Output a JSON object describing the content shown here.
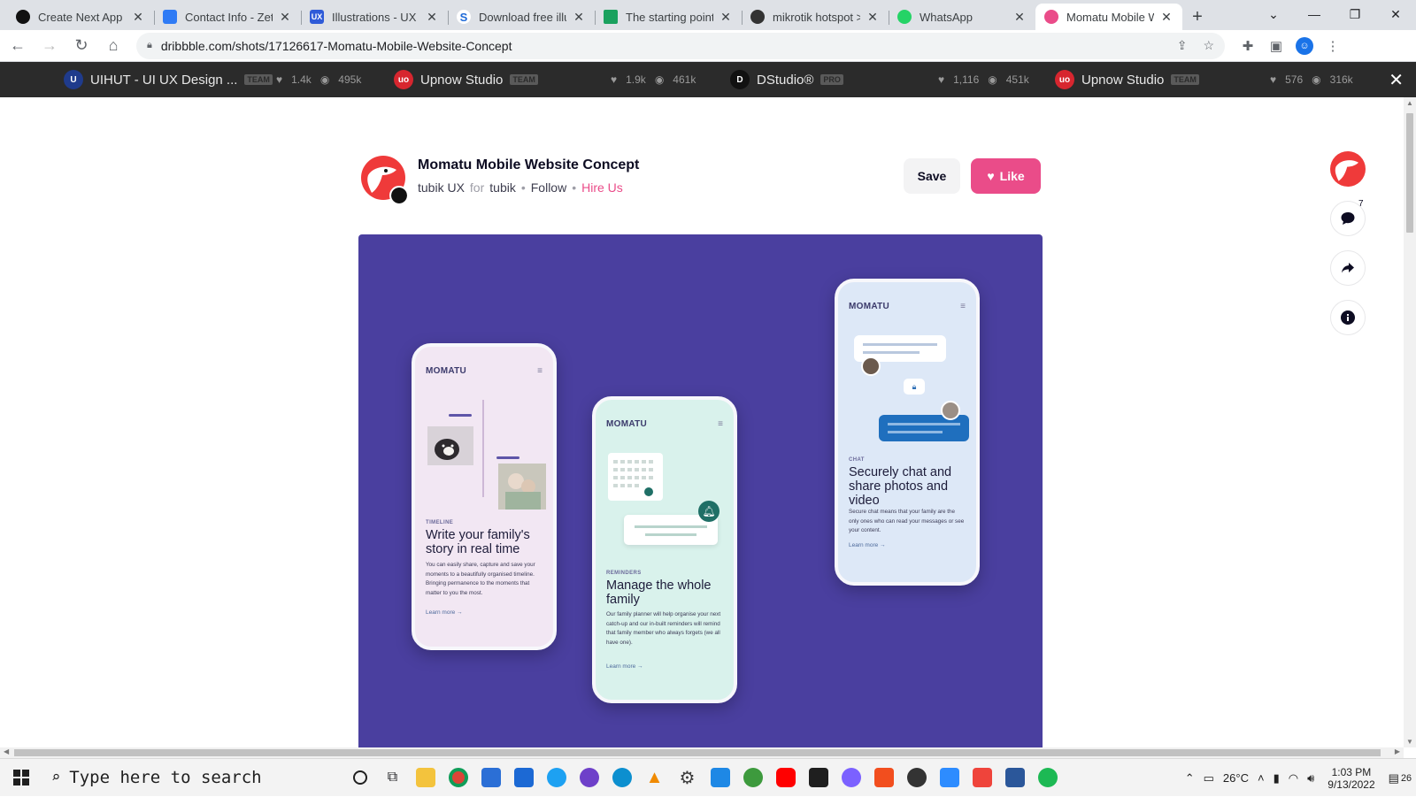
{
  "browser": {
    "tabs": [
      {
        "title": "Create Next App",
        "favicon_color": "#111111"
      },
      {
        "title": "Contact Info - Zety",
        "favicon_color": "#2f7bf5"
      },
      {
        "title": "Illustrations - UX Li",
        "favicon_color": "#2f5bd8",
        "favicon_text": "UX"
      },
      {
        "title": "Download free illus",
        "favicon_color": "#1e6ad8",
        "favicon_text": "S"
      },
      {
        "title": "The starting point f",
        "favicon_color": "#1aa15e"
      },
      {
        "title": "mikrotik hotspot >",
        "favicon_color": "#333333"
      },
      {
        "title": "WhatsApp",
        "favicon_color": "#25d366"
      },
      {
        "title": "Momatu Mobile W",
        "favicon_color": "#ea4c89",
        "active": true
      }
    ],
    "url": "dribbble.com/shots/17126617-Momatu-Mobile-Website-Concept"
  },
  "top_strip": {
    "items": [
      {
        "name": "UIHUT - UI UX Design ...",
        "badge": "TEAM",
        "likes": "1.4k",
        "views": "495k",
        "logo_color": "#1f3b8c",
        "logo_text": "U"
      },
      {
        "name": "Upnow Studio",
        "badge": "TEAM",
        "likes": "1.9k",
        "views": "461k",
        "logo_color": "#d7262f",
        "logo_text": "uo"
      },
      {
        "name": "DStudio®",
        "badge": "PRO",
        "likes": "1,116",
        "views": "451k",
        "logo_color": "#111111",
        "logo_text": "D"
      },
      {
        "name": "Upnow Studio",
        "badge": "TEAM",
        "likes": "576",
        "views": "316k",
        "logo_color": "#d7262f",
        "logo_text": "uo"
      }
    ]
  },
  "shot": {
    "title": "Momatu Mobile Website Concept",
    "author": "tubik UX",
    "for_word": "for",
    "team": "tubik",
    "follow": "Follow",
    "hire": "Hire Us",
    "save_label": "Save",
    "like_label": "Like",
    "comment_count": "7",
    "background_color": "#4a3f9f"
  },
  "phones": {
    "brand": "MOMATU",
    "one": {
      "tag": "TIMELINE",
      "heading": "Write your family's story in real time",
      "body": "You can easily share, capture and save your moments to a beautifully organised timeline. Bringing permanence to the moments that matter to you the most.",
      "link": "Learn more →"
    },
    "two": {
      "tag": "REMINDERS",
      "heading": "Manage the whole family",
      "body": "Our family planner will help organise your next catch-up and our in-built reminders will remind that family member who always forgets (we all have one).",
      "link": "Learn more →"
    },
    "three": {
      "tag": "CHAT",
      "heading": "Securely chat and share photos and video",
      "body": "Secure chat means that your family are the only ones who can read your messages or see your content.",
      "link": "Learn more →"
    }
  },
  "taskbar": {
    "search_placeholder": "Type here to search",
    "temperature": "26°C",
    "time": "1:03 PM",
    "date": "9/13/2022",
    "notification_count": "26"
  }
}
